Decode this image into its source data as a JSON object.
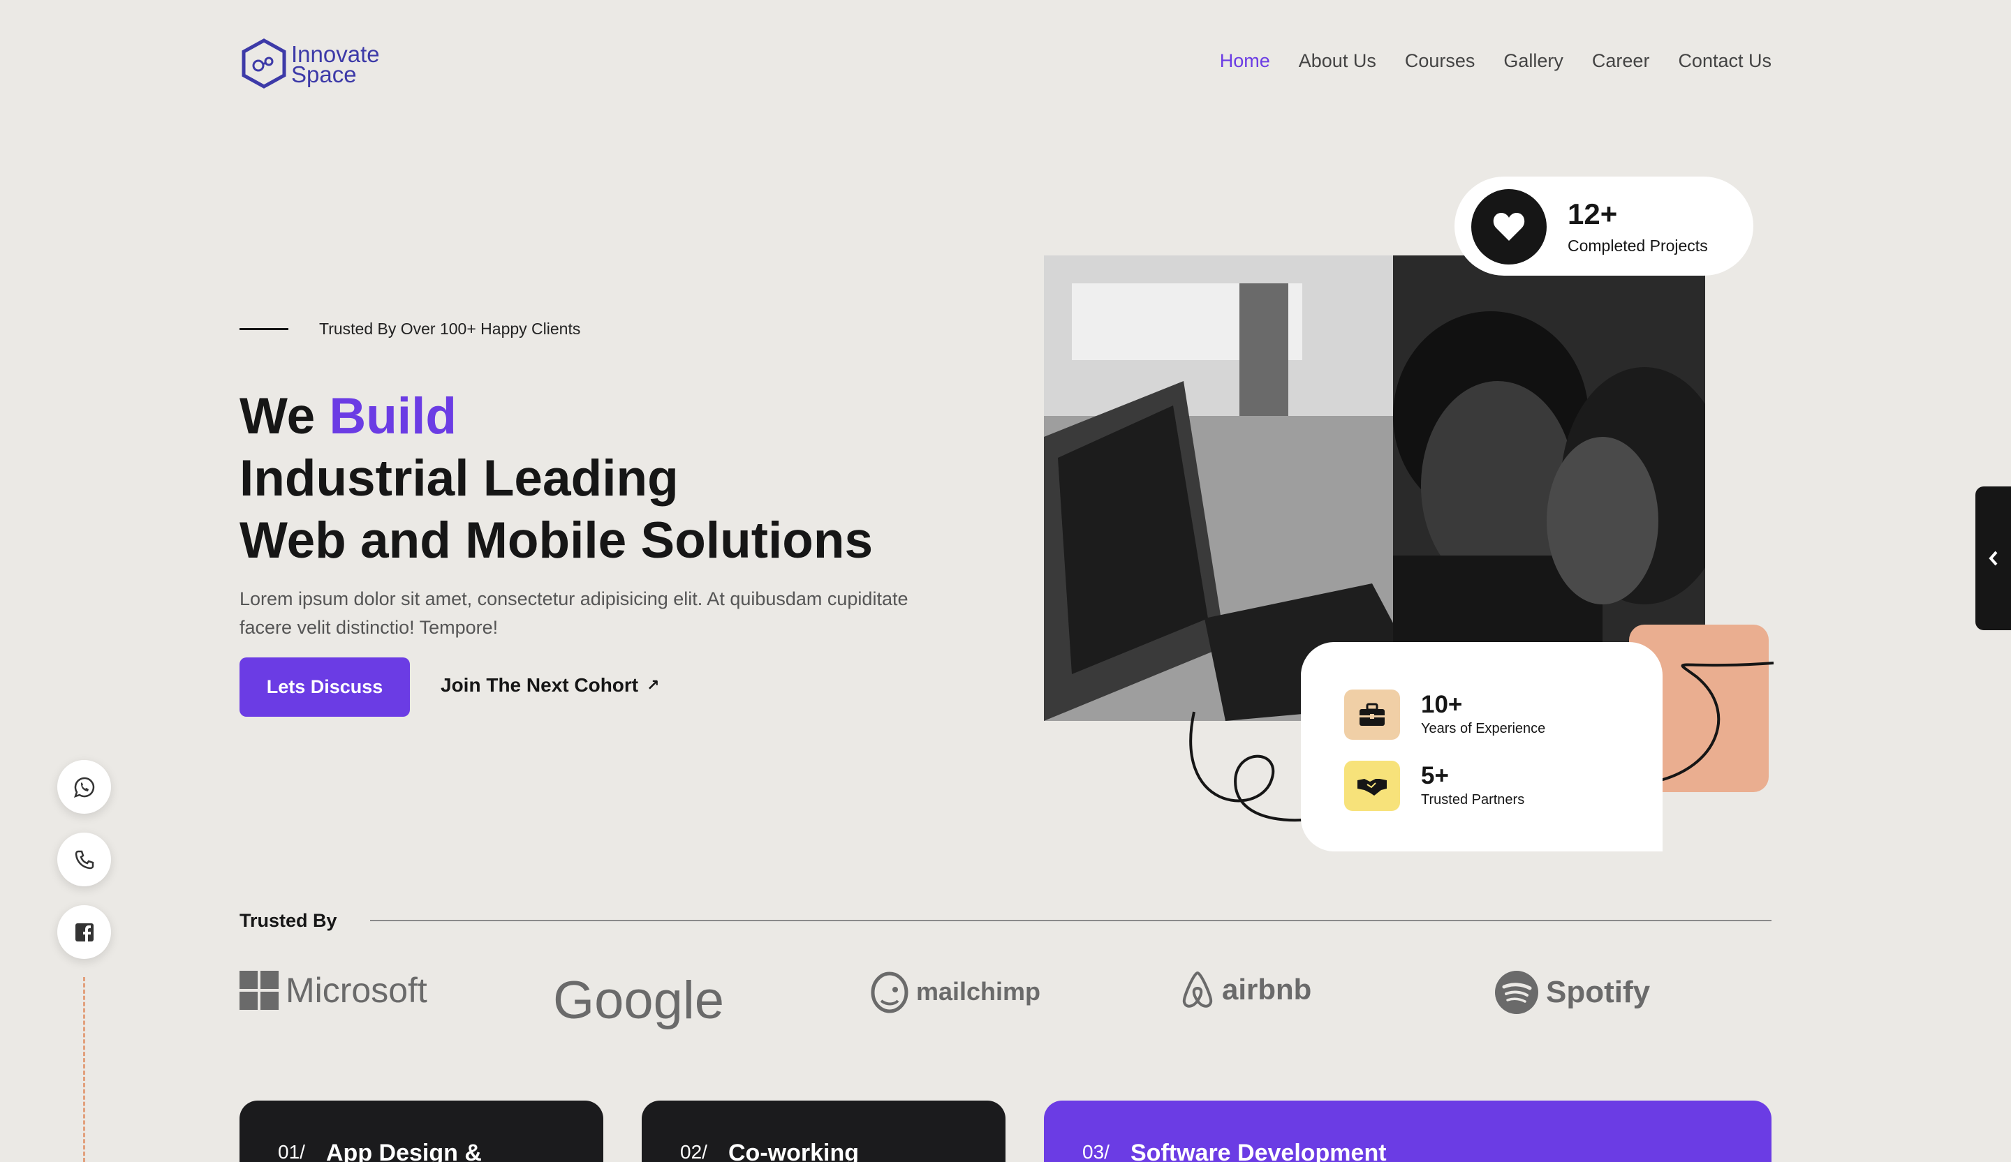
{
  "header": {
    "logo": {
      "line1": "Innovate",
      "line2": "Space"
    },
    "nav": [
      {
        "label": "Home",
        "active": true
      },
      {
        "label": "About Us"
      },
      {
        "label": "Courses"
      },
      {
        "label": "Gallery"
      },
      {
        "label": "Career"
      },
      {
        "label": "Contact Us"
      }
    ]
  },
  "hero": {
    "trusted_text": "Trusted By Over 100+ Happy Clients",
    "title_we": "We",
    "title_build": "Build",
    "title_line2": "Industrial Leading",
    "title_line3": "Web and Mobile Solutions",
    "description": "Lorem ipsum dolor sit amet, consectetur adipisicing elit. At quibusdam cupiditate facere velit distinctio! Tempore!",
    "primary_button": "Lets Discuss",
    "secondary_link": "Join The Next Cohort"
  },
  "stats": {
    "projects": {
      "value": "12+",
      "label": "Completed Projects"
    },
    "experience": {
      "value": "10+",
      "label": "Years of Experience"
    },
    "partners": {
      "value": "5+",
      "label": "Trusted Partners"
    }
  },
  "trusted_by": {
    "heading": "Trusted By",
    "brands": [
      "Microsoft",
      "Google",
      "mailchimp",
      "airbnb",
      "Spotify"
    ]
  },
  "services": [
    {
      "num": "01/",
      "title": "App Design &"
    },
    {
      "num": "02/",
      "title": "Co-working"
    },
    {
      "num": "03/",
      "title": "Software Development"
    }
  ],
  "colors": {
    "accent": "#6b3ce4",
    "background": "#ebe9e5",
    "dark": "#161616",
    "peach": "#eaae90"
  },
  "icons": [
    "heart-icon",
    "briefcase-icon",
    "handshake-icon",
    "whatsapp-icon",
    "phone-icon",
    "facebook-icon",
    "chevron-left-icon",
    "arrow-up-right-icon"
  ]
}
